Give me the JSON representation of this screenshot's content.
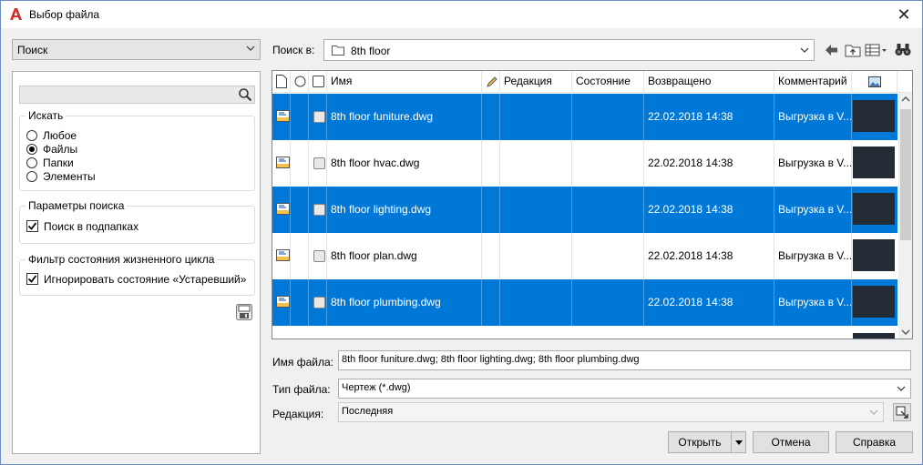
{
  "window": {
    "title": "Выбор файла",
    "close_glyph": "✕"
  },
  "left": {
    "view_select": "Поиск",
    "search_placeholder": "",
    "find_group": {
      "label": "Искать",
      "options": [
        "Любое",
        "Файлы",
        "Папки",
        "Элементы"
      ],
      "selected_index": 1
    },
    "search_params": {
      "label": "Параметры поиска",
      "subfolders": "Поиск в подпапках",
      "subfolders_checked": true
    },
    "lifecycle": {
      "label": "Фильтр состояния жизненного цикла",
      "ignore_obsolete": "Игнорировать состояние «Устаревший»",
      "ignore_checked": true
    }
  },
  "toolbar": {
    "look_in_label": "Поиск в:",
    "look_in_value": "8th floor"
  },
  "list": {
    "columns": [
      "Имя",
      "Редакция",
      "Состояние",
      "Возвращено",
      "Комментарий"
    ],
    "rows": [
      {
        "name": "8th floor funiture.dwg",
        "returned": "22.02.2018 14:38",
        "comment": "Выгрузка в V...",
        "selected": true
      },
      {
        "name": "8th floor hvac.dwg",
        "returned": "22.02.2018 14:38",
        "comment": "Выгрузка в V...",
        "selected": false
      },
      {
        "name": "8th floor lighting.dwg",
        "returned": "22.02.2018 14:38",
        "comment": "Выгрузка в V...",
        "selected": true
      },
      {
        "name": "8th floor plan.dwg",
        "returned": "22.02.2018 14:38",
        "comment": "Выгрузка в V...",
        "selected": false
      },
      {
        "name": "8th floor plumbing.dwg",
        "returned": "22.02.2018 14:38",
        "comment": "Выгрузка в V...",
        "selected": true
      }
    ]
  },
  "form": {
    "filename_label": "Имя файла:",
    "filename_value": "8th floor funiture.dwg; 8th floor lighting.dwg; 8th floor plumbing.dwg",
    "filetype_label": "Тип файла:",
    "filetype_value": "Чертеж (*.dwg)",
    "revision_label": "Редакция:",
    "revision_value": "Последняя"
  },
  "buttons": {
    "open": "Открыть",
    "cancel": "Отмена",
    "help": "Справка"
  },
  "colors": {
    "selection": "#0078d7",
    "accent_red": "#d42a2a"
  }
}
